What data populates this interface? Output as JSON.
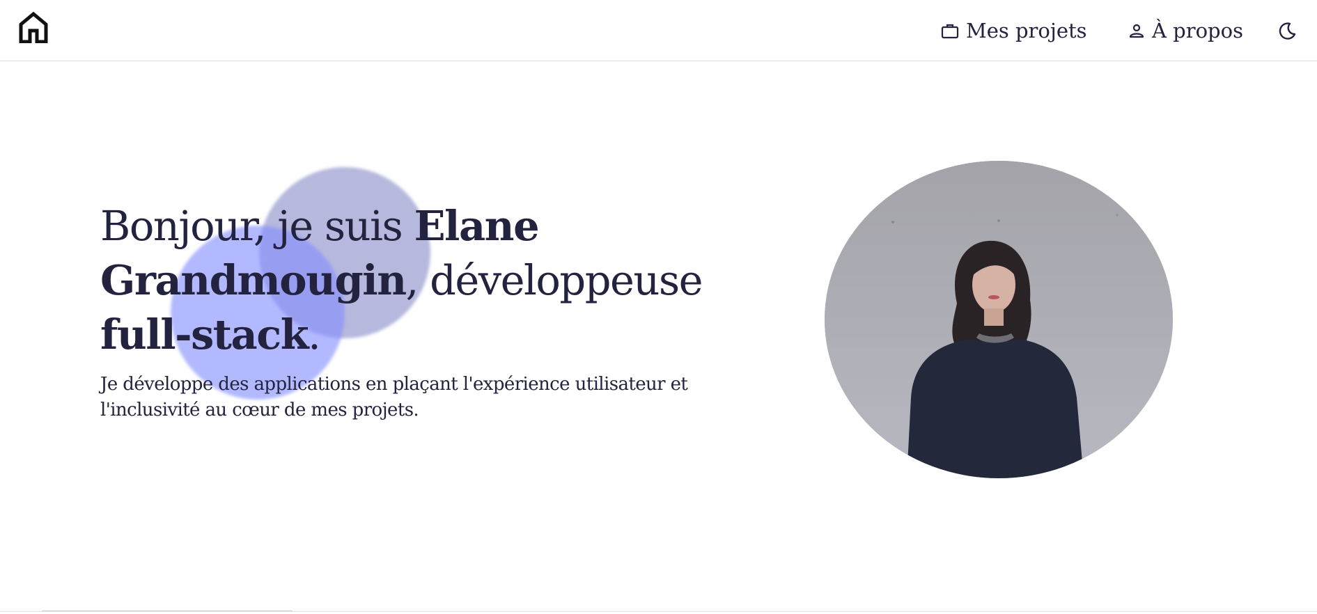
{
  "nav": {
    "home_icon": "home-icon",
    "items": [
      {
        "label": "Mes projets",
        "icon": "briefcase-icon"
      },
      {
        "label": "À propos",
        "icon": "user-icon"
      }
    ],
    "theme_icon": "moon-icon"
  },
  "hero": {
    "headline_1": "Bonjour, je suis ",
    "headline_name_1": "Elane",
    "headline_name_2": "Grandmougin",
    "headline_2": ", développeuse",
    "headline_role": "full-stack",
    "headline_end": ".",
    "subtitle": "Je développe des applications en plaçant l'expérience utilisateur et l'inclusivité au cœur de mes projets."
  },
  "colors": {
    "text": "#23233f",
    "blob_gray": "#898ec8",
    "blob_blue": "#848eff",
    "photo_background": "#a8a8ae",
    "sweater": "#23293a"
  }
}
